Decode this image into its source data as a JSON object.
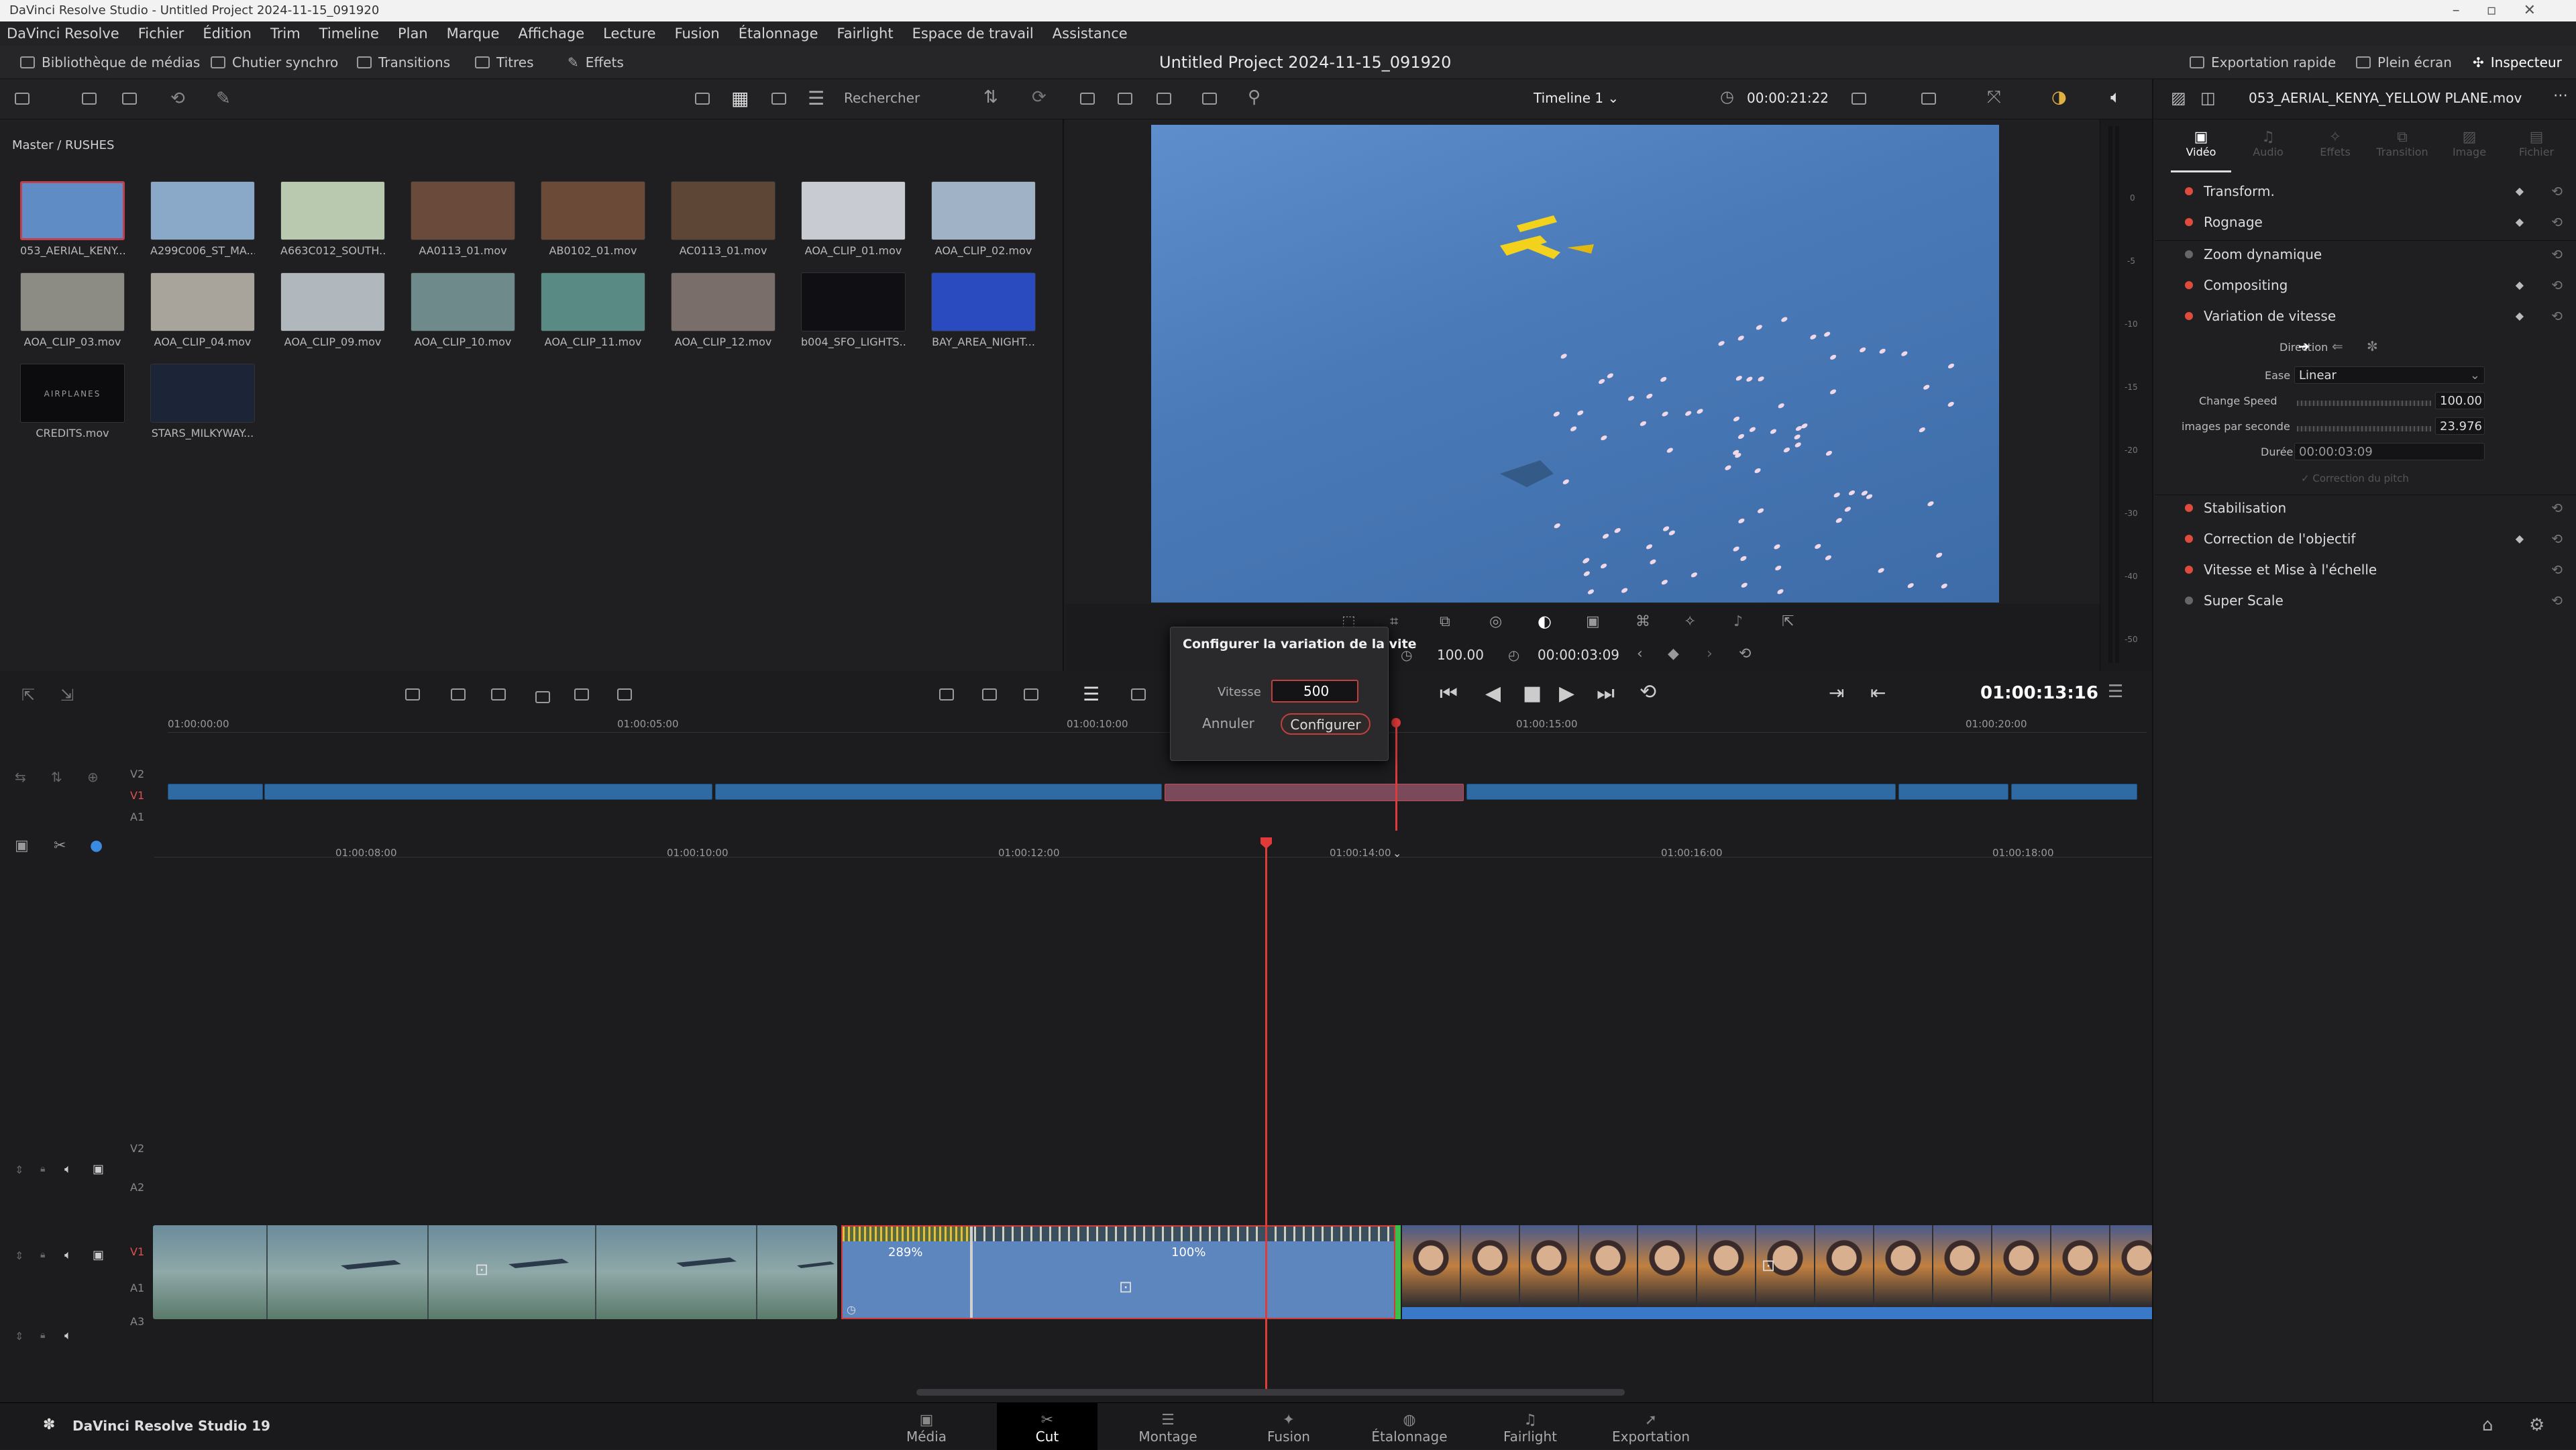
{
  "window_title": "DaVinci Resolve Studio - Untitled Project 2024-11-15_091920",
  "menu": [
    "DaVinci Resolve",
    "Fichier",
    "Édition",
    "Trim",
    "Timeline",
    "Plan",
    "Marque",
    "Affichage",
    "Lecture",
    "Fusion",
    "Étalonnage",
    "Fairlight",
    "Espace de travail",
    "Assistance"
  ],
  "toolbar": {
    "media_library": "Bibliothèque de médias",
    "sync_bin": "Chutier synchro",
    "transitions": "Transitions",
    "titles": "Titres",
    "effects": "Effets",
    "project_title": "Untitled Project 2024-11-15_091920",
    "quick_export": "Exportation rapide",
    "fullscreen": "Plein écran",
    "inspector": "Inspecteur"
  },
  "media": {
    "search_placeholder": "Rechercher",
    "breadcrumb": "Master / RUSHES",
    "clips": [
      {
        "name": "053_AERIAL_KENY...",
        "color": "#5f8cc4"
      },
      {
        "name": "A299C006_ST_MA...",
        "color": "#8aa8c8"
      },
      {
        "name": "A663C012_SOUTH...",
        "color": "#b9c9b0"
      },
      {
        "name": "AA0113_01.mov",
        "color": "#6a4a3a"
      },
      {
        "name": "AB0102_01.mov",
        "color": "#6b4a38"
      },
      {
        "name": "AC0113_01.mov",
        "color": "#5e4636"
      },
      {
        "name": "AOA_CLIP_01.mov",
        "color": "#c8ccd2"
      },
      {
        "name": "AOA_CLIP_02.mov",
        "color": "#9fb2c6"
      },
      {
        "name": "AOA_CLIP_03.mov",
        "color": "#8c8c84"
      },
      {
        "name": "AOA_CLIP_04.mov",
        "color": "#a8a49c"
      },
      {
        "name": "AOA_CLIP_09.mov",
        "color": "#b0b8bd"
      },
      {
        "name": "AOA_CLIP_10.mov",
        "color": "#6e8a8a"
      },
      {
        "name": "AOA_CLIP_11.mov",
        "color": "#5a8a84"
      },
      {
        "name": "AOA_CLIP_12.mov",
        "color": "#7a6e6a"
      },
      {
        "name": "b004_SFO_LIGHTS...",
        "color": "#101014"
      },
      {
        "name": "BAY_AREA_NIGHT...",
        "color": "#2a4ac0"
      },
      {
        "name": "CREDITS.mov",
        "color": "#0c0c0e"
      },
      {
        "name": "STARS_MILKYWAY...",
        "color": "#1c2438"
      }
    ],
    "credits_text": "AIRPLANES"
  },
  "viewer": {
    "timeline_name": "Timeline 1",
    "timecode_top": "00:00:21:22",
    "speed_value": "100.00",
    "duration_value": "00:00:03:09",
    "current_timecode": "01:00:13:16"
  },
  "inspector": {
    "clip_name": "053_AERIAL_KENYA_YELLOW PLANE.mov",
    "tabs": [
      "Vidéo",
      "Audio",
      "Effets",
      "Transition",
      "Image",
      "Fichier"
    ],
    "sections": [
      {
        "label": "Transform.",
        "enabled": true
      },
      {
        "label": "Rognage",
        "enabled": true
      },
      {
        "label": "Zoom dynamique",
        "enabled": false
      },
      {
        "label": "Compositing",
        "enabled": true
      },
      {
        "label": "Variation de vitesse",
        "enabled": true
      },
      {
        "label": "Stabilisation",
        "enabled": true
      },
      {
        "label": "Correction de l'objectif",
        "enabled": true
      },
      {
        "label": "Vitesse et Mise à l'échelle",
        "enabled": true
      },
      {
        "label": "Super Scale",
        "enabled": false
      }
    ],
    "speed": {
      "direction_label": "Direction",
      "ease_label": "Ease",
      "ease_value": "Linear",
      "change_speed_label": "Change Speed",
      "change_speed_value": "100.00",
      "fps_label": "images par seconde",
      "fps_value": "23.976",
      "duration_label": "Durée",
      "duration_value": "00:00:03:09",
      "pitch_label": "Correction du pitch"
    }
  },
  "popup": {
    "title": "Configurer la variation de la vite",
    "speed_label": "Vitesse",
    "speed_value": "500",
    "cancel": "Annuler",
    "confirm": "Configurer"
  },
  "timeline": {
    "upper_ticks": [
      "01:00:00:00",
      "01:00:05:00",
      "01:00:10:00",
      "01:00:15:00",
      "01:00:20:00"
    ],
    "lower_ticks": [
      "01:00:08:00",
      "01:00:10:00",
      "01:00:12:00",
      "01:00:14:00",
      "01:00:16:00",
      "01:00:18:00"
    ],
    "tracks_upper": [
      "V2",
      "V1",
      "A1"
    ],
    "tracks_lower": [
      "V2",
      "A2",
      "V1",
      "A1",
      "A3"
    ],
    "speed_badge_1": "289%",
    "speed_badge_2": "100%"
  },
  "pages": [
    {
      "label": "Média",
      "icon": "▣"
    },
    {
      "label": "Cut",
      "icon": "✂"
    },
    {
      "label": "Montage",
      "icon": "☰"
    },
    {
      "label": "Fusion",
      "icon": "✦"
    },
    {
      "label": "Étalonnage",
      "icon": "◍"
    },
    {
      "label": "Fairlight",
      "icon": "♫"
    },
    {
      "label": "Exportation",
      "icon": "➚"
    }
  ],
  "app_name": "DaVinci Resolve Studio 19",
  "meter_ticks": [
    "0",
    "-5",
    "-10",
    "-15",
    "-20",
    "-30",
    "-40",
    "-50"
  ]
}
